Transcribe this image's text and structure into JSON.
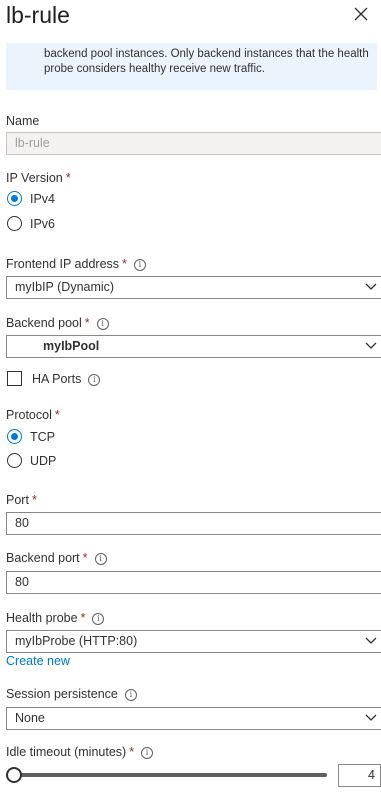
{
  "header": {
    "title": "lb-rule"
  },
  "info": {
    "text": "backend pool instances. Only backend instances that the health probe considers healthy receive new traffic."
  },
  "name": {
    "label": "Name",
    "value": "lb-rule"
  },
  "ip_version": {
    "label": "IP Version",
    "required": "*",
    "options": [
      "IPv4",
      "IPv6"
    ],
    "selected": "IPv4"
  },
  "frontend_ip": {
    "label": "Frontend IP address",
    "required": "*",
    "value": "myIbIP (Dynamic)"
  },
  "backend_pool": {
    "label": "Backend pool",
    "required": "*",
    "value": "myIbPool"
  },
  "ha_ports": {
    "label": "HA Ports",
    "checked": false
  },
  "protocol": {
    "label": "Protocol",
    "required": "*",
    "options": [
      "TCP",
      "UDP"
    ],
    "selected": "TCP"
  },
  "port": {
    "label": "Port",
    "required": "*",
    "value": "80"
  },
  "backend_port": {
    "label": "Backend port",
    "required": "*",
    "value": "80"
  },
  "health_probe": {
    "label": "Health probe",
    "required": "*",
    "value": "myIbProbe (HTTP:80)",
    "create_link": "Create new"
  },
  "session_persistence": {
    "label": "Session persistence",
    "value": "None"
  },
  "idle_timeout": {
    "label": "Idle timeout (minutes)",
    "required": "*",
    "value": "4",
    "min_fraction": 0
  },
  "icons": {
    "close": "close-icon",
    "info": "info-icon",
    "chevron": "chevron-down-icon"
  },
  "colors": {
    "accent": "#0078d4",
    "required": "#a4262c",
    "info_bg": "#ebf3fc"
  }
}
